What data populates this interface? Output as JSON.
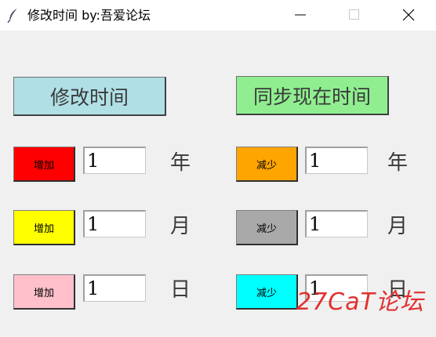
{
  "window": {
    "title": "修改时间 by:吾爱论坛",
    "icon": "feather-icon",
    "controls": [
      "minimize-icon",
      "maximize-icon",
      "close-icon"
    ]
  },
  "main_buttons": {
    "modify_label": "修改时间",
    "sync_label": "同步现在时间"
  },
  "increase": {
    "label": "增加",
    "year_value": "1",
    "month_value": "1",
    "day_value": "1"
  },
  "decrease": {
    "label": "减少",
    "year_value": "1",
    "month_value": "1",
    "day_value": "1"
  },
  "units": {
    "year": "年",
    "month": "月",
    "day": "日"
  },
  "colors": {
    "modify_button": "#b0e0e6",
    "sync_button": "#90ee90",
    "increase_year": "#ff0000",
    "increase_month": "#ffff00",
    "increase_day": "#ffc0cb",
    "decrease_year": "#ffa500",
    "decrease_month": "#a9a9a9",
    "decrease_day": "#00ffff",
    "watermark": "#e23030"
  },
  "watermark": "27CaT论坛"
}
